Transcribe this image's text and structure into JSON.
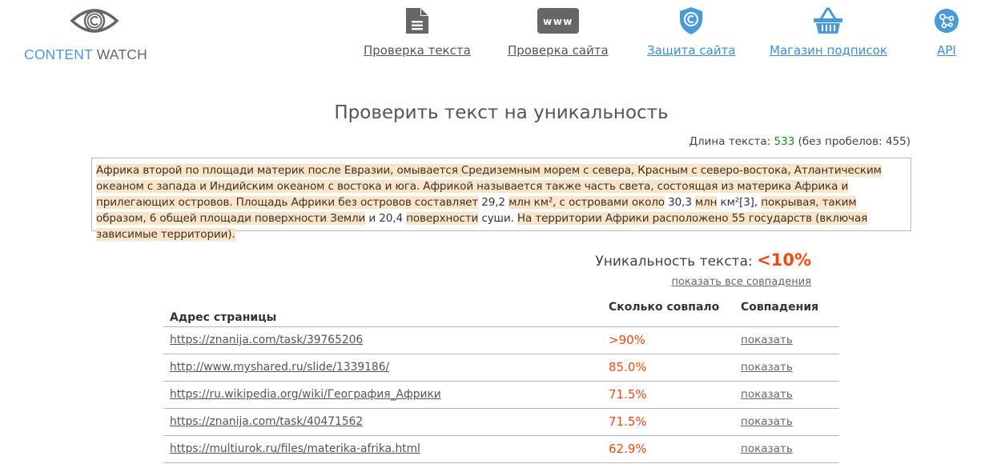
{
  "logo": {
    "icon": "copyright-eye-icon",
    "text_part1": "CONTENT",
    "text_part2": " WATCH",
    "colors": {
      "primary": "#4a9ad8",
      "secondary": "#666666"
    }
  },
  "nav": [
    {
      "label": "Проверка текста",
      "icon": "document-icon",
      "style": "gray"
    },
    {
      "label": "Проверка сайта",
      "icon": "www-icon",
      "style": "gray"
    },
    {
      "label": "Защита сайта",
      "icon": "shield-copyright-icon",
      "style": "blue"
    },
    {
      "label": "Магазин подписок",
      "icon": "basket-icon",
      "style": "blue"
    },
    {
      "label": "API",
      "icon": "api-nodes-icon",
      "style": "blue"
    }
  ],
  "page_title": "Проверить текст на уникальность",
  "text_length": {
    "label": "Длина текста: ",
    "value": "533",
    "no_spaces": " (без пробелов: 455)"
  },
  "checked_text": {
    "segments": [
      {
        "text": "Африка второй по площади материк после Евразии, омывается Средиземным морем с севера, Красным с северо-востока, Атлантическим океаном с запада и Индийским океаном с востока и юга. Африкой называется также часть света, состоящая из материка Африка и прилегающих островов. Площадь Африки без островов составляет",
        "highlight": true
      },
      {
        "text": " 29,2 ",
        "highlight": false
      },
      {
        "text": "млн км², с островами около",
        "highlight": true
      },
      {
        "text": " 30,3 ",
        "highlight": false
      },
      {
        "text": "млн",
        "highlight": true
      },
      {
        "text": " км²[3], ",
        "highlight": false
      },
      {
        "text": "покрывая, таким образом, 6 общей площади поверхности Земли",
        "highlight": true
      },
      {
        "text": " и 20,4 ",
        "highlight": false
      },
      {
        "text": "поверхности",
        "highlight": true
      },
      {
        "text": " суши. ",
        "highlight": false
      },
      {
        "text": "На территории Африки расположено 55 государств (включая зависимые территории).",
        "highlight": true
      }
    ]
  },
  "uniqueness": {
    "label": "Уникальность текста: ",
    "value": "<10%",
    "show_all_link": "показать все совпадения"
  },
  "results_table": {
    "headers": [
      "Адрес страницы",
      "Сколько совпало",
      "Совпадения"
    ],
    "rows": [
      {
        "url": "https://znanija.com/task/39765206",
        "match": ">90%",
        "action": "показать"
      },
      {
        "url": "http://www.myshared.ru/slide/1339186/",
        "match": "85.0%",
        "action": "показать"
      },
      {
        "url": "https://ru.wikipedia.org/wiki/География_Африки",
        "match": "71.5%",
        "action": "показать"
      },
      {
        "url": "https://znanija.com/task/40471562",
        "match": "71.5%",
        "action": "показать"
      },
      {
        "url": "https://multiurok.ru/files/materika-afrika.html",
        "match": "62.9%",
        "action": "показать"
      }
    ]
  },
  "colors": {
    "accent_blue": "#3b8fd4",
    "match_red": "#f04a14",
    "length_green": "#1e8a1e",
    "highlight": "#fde4c6"
  }
}
